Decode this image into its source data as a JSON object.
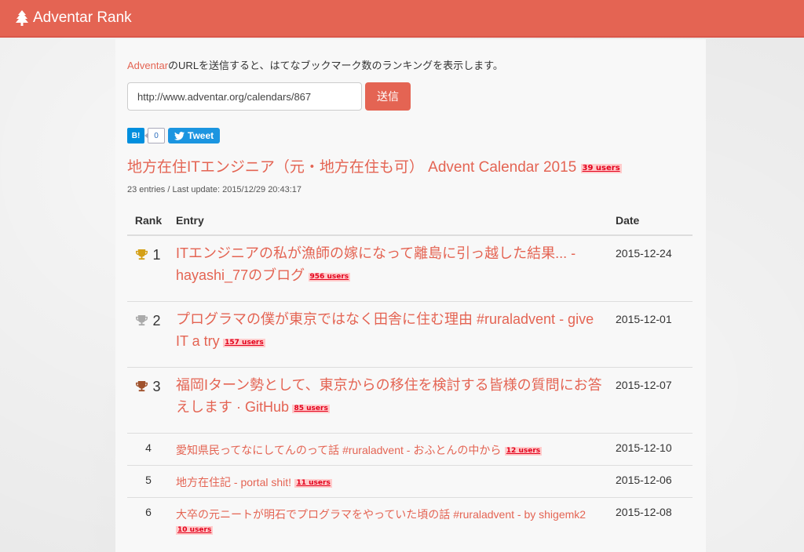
{
  "navbar": {
    "brand": "Adventar Rank",
    "brand_icon": "tree-icon"
  },
  "intro": {
    "link_text": "Adventar",
    "text": "のURLを送信すると、はてなブックマーク数のランキングを表示します。"
  },
  "form": {
    "url_value": "http://www.adventar.org/calendars/867",
    "submit_label": "送信"
  },
  "share": {
    "hatena_label": "B!",
    "hatena_count": "0",
    "tweet_label": "Tweet"
  },
  "calendar": {
    "title": "地方在住ITエンジニア（元・地方在住も可） Advent Calendar 2015",
    "users": "39 users",
    "meta": "23 entries / Last update: 2015/12/29 20:43:17"
  },
  "table": {
    "headers": {
      "rank": "Rank",
      "entry": "Entry",
      "date": "Date"
    },
    "rows": [
      {
        "rank": "1",
        "trophy": "gold",
        "title": "ITエンジニアの私が漁師の嫁になって離島に引っ越した結果... - hayashi_77のブログ",
        "users": "956 users",
        "date": "2015-12-24"
      },
      {
        "rank": "2",
        "trophy": "silver",
        "title": "プログラマの僕が東京ではなく田舎に住む理由 #ruraladvent - give IT a try",
        "users": "157 users",
        "date": "2015-12-01"
      },
      {
        "rank": "3",
        "trophy": "bronze",
        "title": "福岡Iターン勢として、東京からの移住を検討する皆様の質問にお答えします · GitHub",
        "users": "85 users",
        "date": "2015-12-07"
      },
      {
        "rank": "4",
        "title": "愛知県民ってなにしてんのって話 #ruraladvent - おふとんの中から",
        "users": "12 users",
        "date": "2015-12-10"
      },
      {
        "rank": "5",
        "title": "地方在住記 - portal shit!",
        "users": "11 users",
        "date": "2015-12-06"
      },
      {
        "rank": "6",
        "title": "大卒の元ニートが明石でプログラマをやっていた頃の話 #ruraladvent - by shigemk2",
        "users": "10 users",
        "date": "2015-12-08"
      }
    ]
  },
  "colors": {
    "accent": "#e46453",
    "gold": "#d4a017",
    "silver": "#aaaaaa",
    "bronze": "#a0522d",
    "badge_bg": "#ffcccc",
    "badge_text": "#e3001b"
  }
}
